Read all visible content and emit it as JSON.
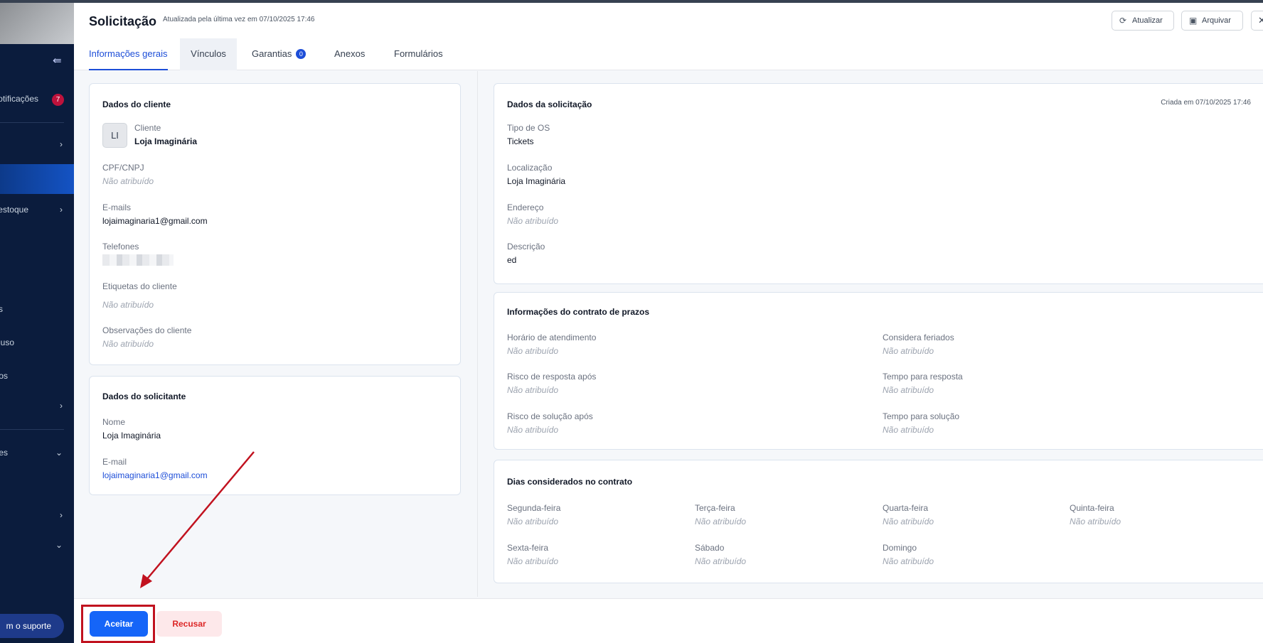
{
  "sidebar": {
    "items": [
      {
        "label": "otificações",
        "badge": "7"
      },
      {
        "label": ""
      },
      {
        "label": "estoque"
      },
      {
        "label": "s"
      },
      {
        "label": "uso"
      },
      {
        "label": "os"
      },
      {
        "label": "es"
      }
    ],
    "support_label": "m o suporte"
  },
  "header": {
    "title": "Solicitação",
    "subtitle": "Atualizada pela última vez em  07/10/2025 17:46",
    "refresh_label": "Atualizar",
    "archive_label": "Arquivar",
    "close_label": "✕"
  },
  "tabs": [
    {
      "label": "Informações gerais"
    },
    {
      "label": "Vínculos"
    },
    {
      "label": "Garantias",
      "badge": "0"
    },
    {
      "label": "Anexos"
    },
    {
      "label": "Formulários"
    }
  ],
  "client": {
    "title": "Dados do cliente",
    "avatar": "LI",
    "client_label": "Cliente",
    "client_value": "Loja Imaginária",
    "cpf_label": "CPF/CNPJ",
    "cpf_value": "Não atribuído",
    "emails_label": "E-mails",
    "emails_value": "lojaimaginaria1@gmail.com",
    "phones_label": "Telefones",
    "tags_label": "Etiquetas do cliente",
    "tags_value": "Não atribuído",
    "notes_label": "Observações do cliente",
    "notes_value": "Não atribuído"
  },
  "requester": {
    "title": "Dados do solicitante",
    "name_label": "Nome",
    "name_value": "Loja Imaginária",
    "email_label": "E-mail",
    "email_value": "lojaimaginaria1@gmail.com"
  },
  "request": {
    "title": "Dados da solicitação",
    "created": "Criada em 07/10/2025 17:46",
    "type_label": "Tipo de OS",
    "type_value": "Tickets",
    "location_label": "Localização",
    "location_value": "Loja Imaginária",
    "address_label": "Endereço",
    "address_value": "Não atribuído",
    "description_label": "Descrição",
    "description_value": "ed"
  },
  "contract": {
    "title": "Informações do contrato de prazos",
    "fields": [
      {
        "label": "Horário de atendimento",
        "value": "Não atribuído"
      },
      {
        "label": "Considera feriados",
        "value": "Não atribuído"
      },
      {
        "label": "Risco de resposta após",
        "value": "Não atribuído"
      },
      {
        "label": "Tempo para resposta",
        "value": "Não atribuído"
      },
      {
        "label": "Risco de solução após",
        "value": "Não atribuído"
      },
      {
        "label": "Tempo para solução",
        "value": "Não atribuído"
      }
    ]
  },
  "days": {
    "title": "Dias considerados no contrato",
    "fields": [
      {
        "label": "Segunda-feira",
        "value": "Não atribuído"
      },
      {
        "label": "Terça-feira",
        "value": "Não atribuído"
      },
      {
        "label": "Quarta-feira",
        "value": "Não atribuído"
      },
      {
        "label": "Quinta-feira",
        "value": "Não atribuído"
      },
      {
        "label": "Sexta-feira",
        "value": "Não atribuído"
      },
      {
        "label": "Sábado",
        "value": "Não atribuído"
      },
      {
        "label": "Domingo",
        "value": "Não atribuído"
      }
    ]
  },
  "footer": {
    "accept_label": "Aceitar",
    "reject_label": "Recusar"
  },
  "colors": {
    "primary": "#1565f8",
    "annotation": "#c1121f",
    "sidebar": "#0b1c3d"
  }
}
